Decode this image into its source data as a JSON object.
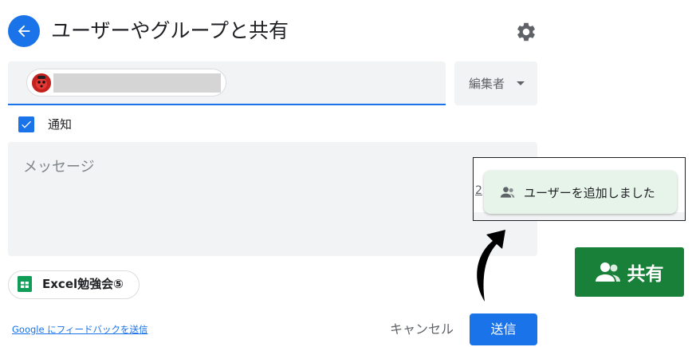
{
  "header": {
    "title": "ユーザーやグループと共有",
    "back_icon": "arrow-left-icon",
    "settings_icon": "gear-icon"
  },
  "recipient": {
    "avatar_icon": "avatar-icon"
  },
  "role": {
    "selected": "編集者"
  },
  "notify": {
    "label": "通知",
    "checked": true
  },
  "message": {
    "placeholder": "メッセージ"
  },
  "file": {
    "name": "Excel勉強会⑤",
    "icon": "sheets-icon"
  },
  "footer": {
    "feedback_link": "Google にフィードバックを送信",
    "cancel_label": "キャンセル",
    "send_label": "送信"
  },
  "toast": {
    "message": "ユーザーを追加しました",
    "icon": "person-add-icon",
    "partial_text": "2"
  },
  "share_button": {
    "label": "共有",
    "icon": "people-icon"
  },
  "colors": {
    "accent": "#1a73e8",
    "share_green": "#188038",
    "toast_bg": "#e6f4ea"
  }
}
